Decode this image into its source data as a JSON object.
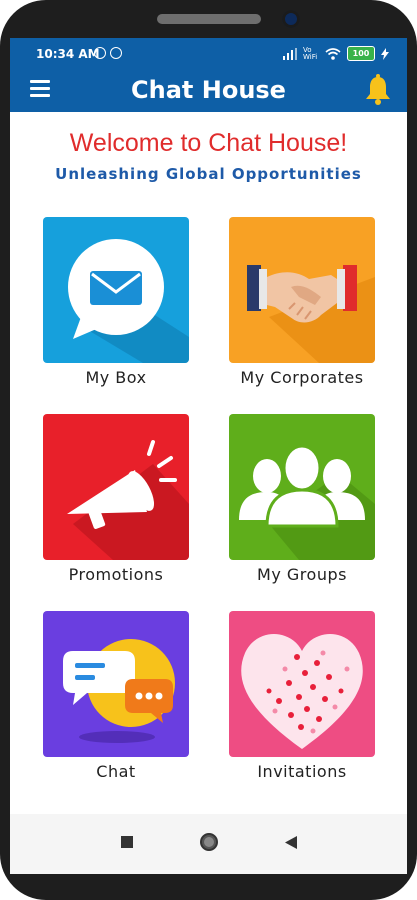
{
  "status_bar": {
    "time": "10:34 AM",
    "network_label": "Vo WiFi",
    "battery": "100"
  },
  "app_bar": {
    "title": "Chat House",
    "menu_icon": "hamburger-menu-icon",
    "notification_icon": "bell-icon"
  },
  "welcome": {
    "heading": "Welcome to Chat House!",
    "tagline": "Unleashing Global Opportunities"
  },
  "tiles": [
    {
      "label": "My Box",
      "icon": "envelope-icon",
      "color": "#16a0dc"
    },
    {
      "label": "My Corporates",
      "icon": "handshake-icon",
      "color": "#f8a124"
    },
    {
      "label": "Promotions",
      "icon": "megaphone-icon",
      "color": "#e8202a"
    },
    {
      "label": "My Groups",
      "icon": "group-icon",
      "color": "#5fae1b"
    },
    {
      "label": "Chat",
      "icon": "chat-bubbles-icon",
      "color": "#6a3ee0"
    },
    {
      "label": "Invitations",
      "icon": "heart-icon",
      "color": "#ee4d83"
    }
  ],
  "nav_bar": {
    "recents_icon": "square-icon",
    "home_icon": "circle-icon",
    "back_icon": "triangle-back-icon"
  }
}
